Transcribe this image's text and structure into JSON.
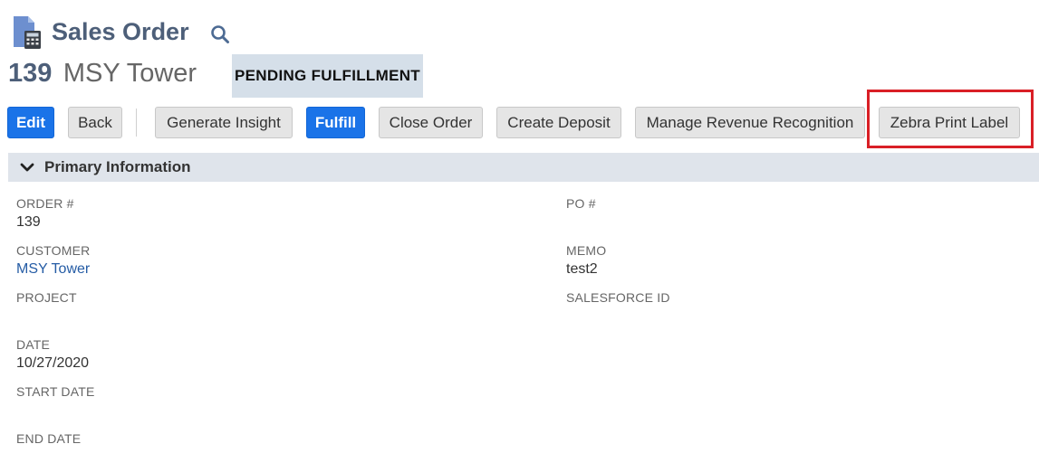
{
  "header": {
    "title": "Sales Order",
    "record_number": "139",
    "record_name": "MSY Tower",
    "status": "PENDING FULFILLMENT",
    "icons": {
      "record": "sales-order-document-icon",
      "search": "search-icon"
    }
  },
  "toolbar": {
    "edit_label": "Edit",
    "back_label": "Back",
    "generate_insight_label": "Generate Insight",
    "fulfill_label": "Fulfill",
    "close_order_label": "Close Order",
    "create_deposit_label": "Create Deposit",
    "manage_revenue_label": "Manage Revenue Recognition",
    "zebra_print_label": "Zebra Print Label"
  },
  "section": {
    "title": "Primary Information"
  },
  "fields": {
    "order_number": {
      "label": "ORDER #",
      "value": "139"
    },
    "po_number": {
      "label": "PO #",
      "value": ""
    },
    "customer": {
      "label": "CUSTOMER",
      "value": "MSY Tower"
    },
    "memo": {
      "label": "MEMO",
      "value": "test2"
    },
    "project": {
      "label": "PROJECT",
      "value": ""
    },
    "salesforce_id": {
      "label": "SALESFORCE ID",
      "value": ""
    },
    "date": {
      "label": "DATE",
      "value": "10/27/2020"
    },
    "start_date": {
      "label": "START DATE",
      "value": ""
    },
    "end_date": {
      "label": "END DATE",
      "value": ""
    }
  },
  "colors": {
    "primary_button": "#1a73e8",
    "title_text": "#4d5f79",
    "status_badge_bg": "#d5dfe9",
    "section_bg": "#dfe4eb",
    "highlight": "#d91f26",
    "link": "#255ca5"
  }
}
